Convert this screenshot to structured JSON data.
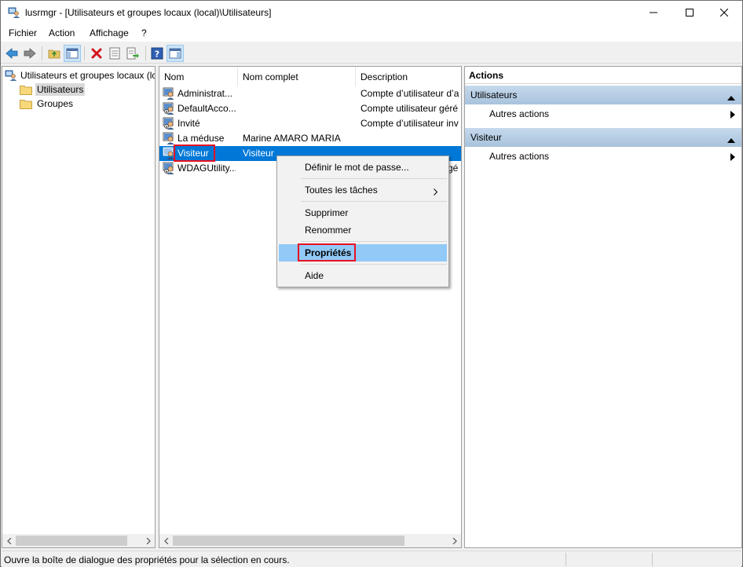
{
  "window": {
    "title": "lusrmgr - [Utilisateurs et groupes locaux (local)\\Utilisateurs]"
  },
  "menu": [
    "Fichier",
    "Action",
    "Affichage",
    "?"
  ],
  "toolbar": {
    "icons": [
      "back-arrow-icon",
      "forward-arrow-icon",
      "up-folder-icon",
      "show-hide-tree-icon",
      "delete-icon",
      "properties-icon",
      "export-list-icon",
      "help-icon",
      "show-hide-action-pane-icon"
    ]
  },
  "tree": {
    "root": "Utilisateurs et groupes locaux (lc",
    "items": [
      {
        "label": "Utilisateurs",
        "selected": true
      },
      {
        "label": "Groupes",
        "selected": false
      }
    ]
  },
  "list": {
    "columns": [
      "Nom",
      "Nom complet",
      "Description"
    ],
    "rows": [
      {
        "name": "Administrat...",
        "full": "",
        "desc": "Compte d’utilisateur d’a"
      },
      {
        "name": "DefaultAcco...",
        "full": "",
        "desc": "Compte utilisateur géré"
      },
      {
        "name": "Invité",
        "full": "",
        "desc": "Compte d’utilisateur inv"
      },
      {
        "name": "La méduse",
        "full": "Marine AMARO MARIA",
        "desc": ""
      },
      {
        "name": "Visiteur",
        "full": "Visiteur",
        "desc": ""
      },
      {
        "name": "WDAGUtility...",
        "full": "",
        "desc": "gé"
      }
    ]
  },
  "context_menu": {
    "items": [
      {
        "label": "Définir le mot de passe...",
        "submenu": false,
        "highlight": false
      },
      {
        "label": "Toutes les tâches",
        "submenu": true,
        "highlight": false
      },
      {
        "label": "Supprimer",
        "submenu": false,
        "highlight": false
      },
      {
        "label": "Renommer",
        "submenu": false,
        "highlight": false
      },
      {
        "label": "Propriétés",
        "submenu": false,
        "highlight": true
      },
      {
        "label": "Aide",
        "submenu": false,
        "highlight": false
      }
    ]
  },
  "actions": {
    "title": "Actions",
    "sections": [
      {
        "header": "Utilisateurs",
        "item": "Autres actions"
      },
      {
        "header": "Visiteur",
        "item": "Autres actions"
      }
    ]
  },
  "status": {
    "text": "Ouvre la boîte de dialogue des propriétés pour la sélection en cours."
  },
  "colors": {
    "selection": "#0078d7",
    "hover": "#91c9f7",
    "annotation": "#e81123",
    "section_header": "#b7cee5"
  }
}
